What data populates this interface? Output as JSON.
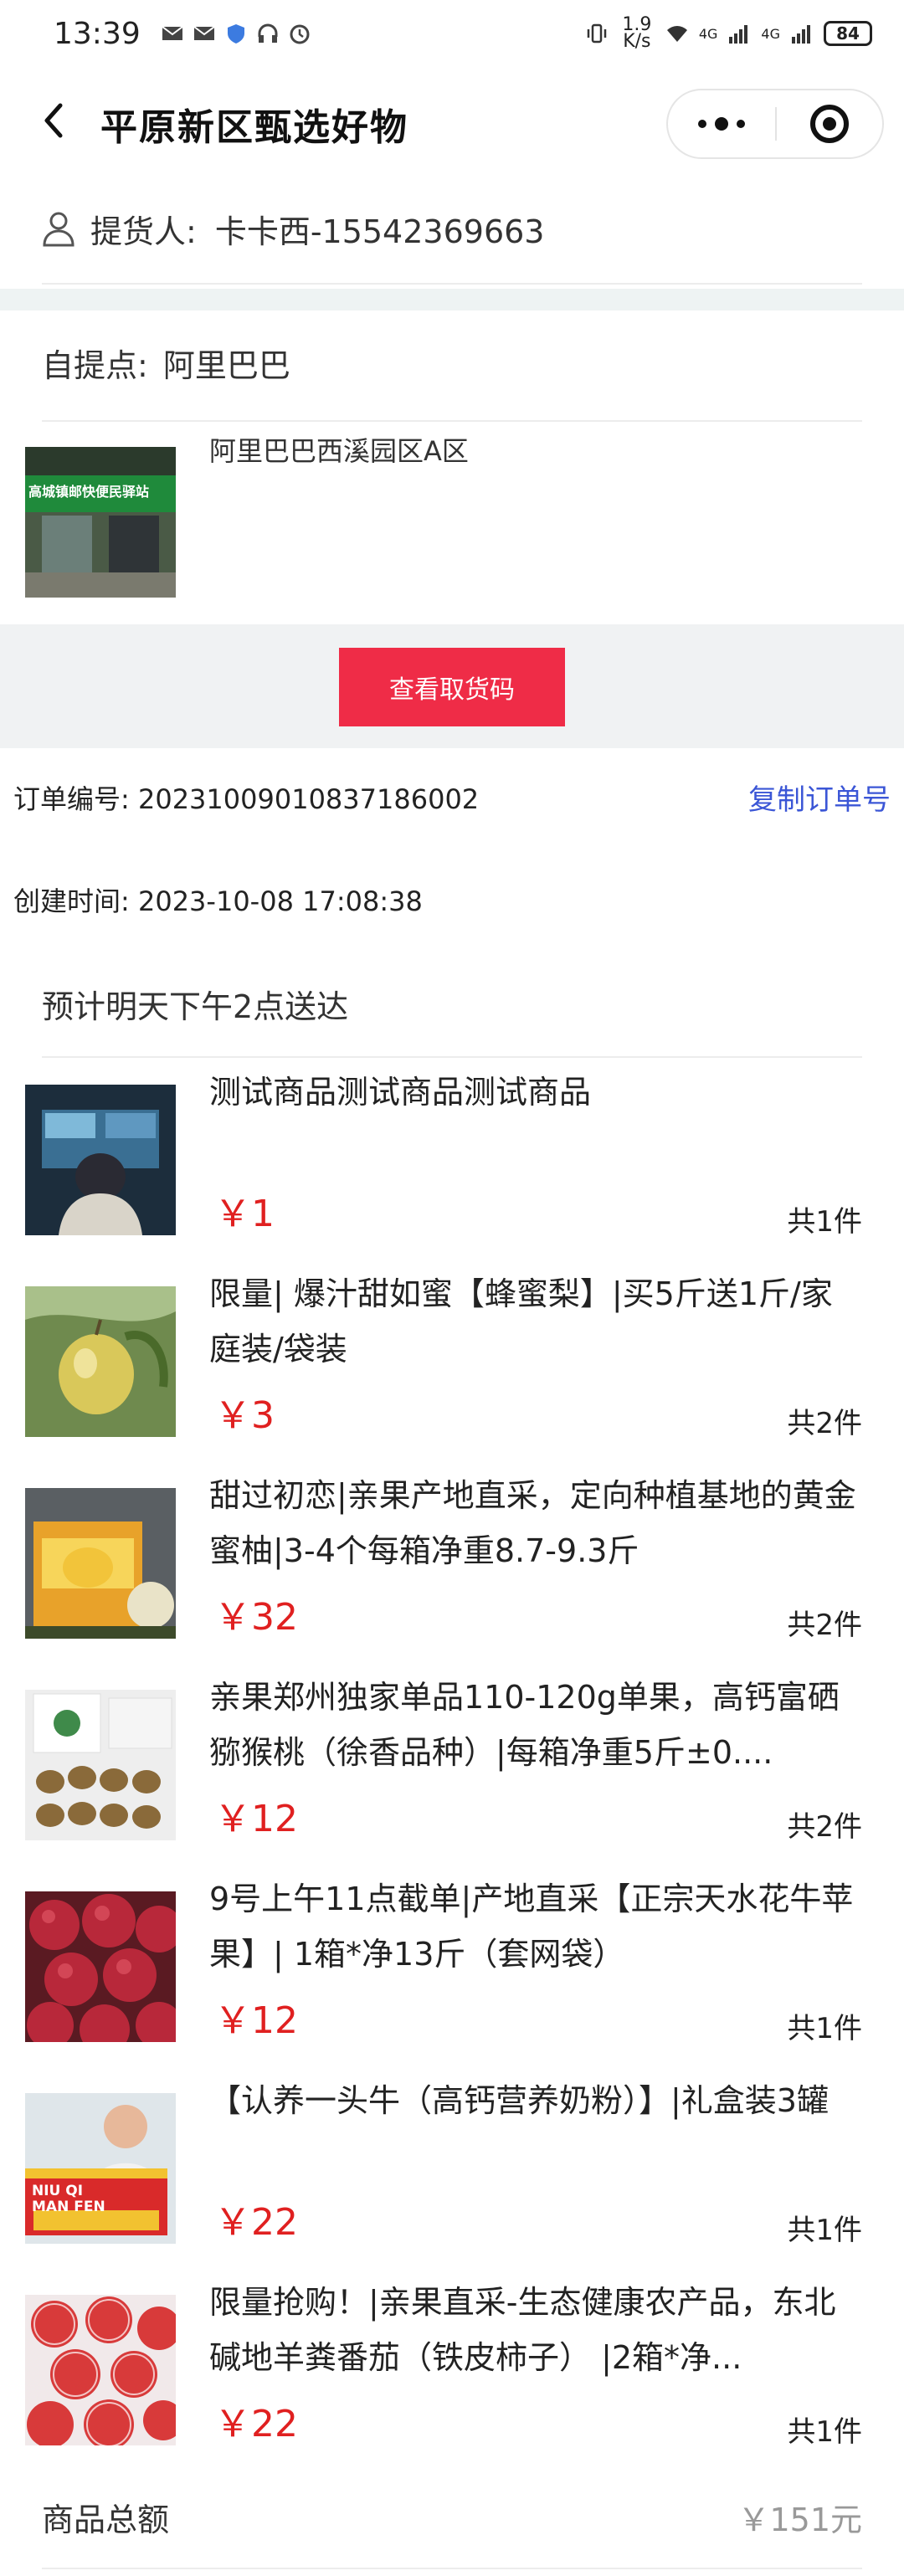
{
  "status_bar": {
    "time": "13:39",
    "net_speed": "1.9 K/s",
    "net1": "4G",
    "net2": "4G",
    "battery": "84"
  },
  "nav": {
    "title": "平原新区甄选好物"
  },
  "pickup": {
    "label": "提货人:",
    "value": "卡卡西-15542369663"
  },
  "self_pickup": {
    "label": "自提点:",
    "value": "阿里巴巴",
    "store_name": "阿里巴巴西溪园区A区",
    "store_sign": "高城镇邮快便民驿站"
  },
  "pickup_code_button": "查看取货码",
  "order": {
    "number_label": "订单编号:",
    "number": "20231009010837186002",
    "copy_label": "复制订单号",
    "created_label": "创建时间:",
    "created": "2023-10-08 17:08:38",
    "eta": "预计明天下午2点送达"
  },
  "products": [
    {
      "name": "测试商品测试商品测试商品",
      "price": "￥1",
      "qty": "共1件",
      "image": "tech-screen"
    },
    {
      "name": "限量| 爆汁甜如蜜【蜂蜜梨】|买5斤送1斤/家庭装/袋装",
      "price": "￥3",
      "qty": "共2件",
      "image": "pear"
    },
    {
      "name": "甜过初恋|亲果产地直采，定向种植基地的黄金蜜柚|3-4个每箱净重8.7-9.3斤",
      "price": "￥32",
      "qty": "共2件",
      "image": "pomelo-box"
    },
    {
      "name": "亲果郑州独家单品110-120g单果，高钙富硒猕猴桃（徐香品种）|每箱净重5斤±0....",
      "price": "￥12",
      "qty": "共2件",
      "image": "kiwi"
    },
    {
      "name": "9号上午11点截单|产地直采【正宗天水花牛苹果】| 1箱*净13斤（套网袋）",
      "price": "￥12",
      "qty": "共1件",
      "image": "apples"
    },
    {
      "name": "【认养一头牛（高钙营养奶粉）】|礼盒装3罐",
      "price": "￥22",
      "qty": "共1件",
      "image": "milk-box",
      "image_text": "NIU QI MAN FEN"
    },
    {
      "name": "限量抢购！|亲果直采-生态健康农产品，东北碱地羊粪番茄（铁皮柿子） |2箱*净...",
      "price": "￥22",
      "qty": "共1件",
      "image": "tomatoes"
    }
  ],
  "total": {
    "label": "商品总额",
    "value": "￥151元"
  },
  "colors": {
    "accent_red": "#ef2c47",
    "price_red": "#e02020",
    "link_blue": "#3b56d6"
  }
}
